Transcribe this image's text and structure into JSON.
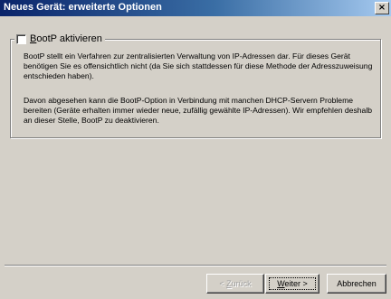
{
  "window": {
    "title": "Neues Gerät: erweiterte Optionen",
    "close_glyph": "×"
  },
  "bootp": {
    "checked": false,
    "label_accel": "B",
    "label_rest": "ootP aktivieren",
    "paragraph1": "BootP stellt ein Verfahren zur zentralisierten Verwaltung von IP-Adressen dar. Für dieses Gerät benötigen Sie es offensichtlich nicht (da Sie sich stattdessen für diese Methode der Adresszuweisung entschieden haben).",
    "paragraph2": "Davon abgesehen kann die BootP-Option in Verbindung mit manchen DHCP-Servern Probleme bereiten (Geräte erhalten immer wieder neue, zufällig gewählte IP-Adressen). Wir empfehlen deshalb an dieser Stelle, BootP zu deaktivieren."
  },
  "buttons": {
    "back_pre": "< ",
    "back_accel": "Z",
    "back_rest": "urück",
    "back_enabled": false,
    "next_accel": "W",
    "next_rest": "eiter >",
    "cancel_label": "Abbrechen"
  },
  "colors": {
    "titlebar_start": "#0a246a",
    "titlebar_end": "#a6caf0",
    "face": "#d4d0c8"
  }
}
